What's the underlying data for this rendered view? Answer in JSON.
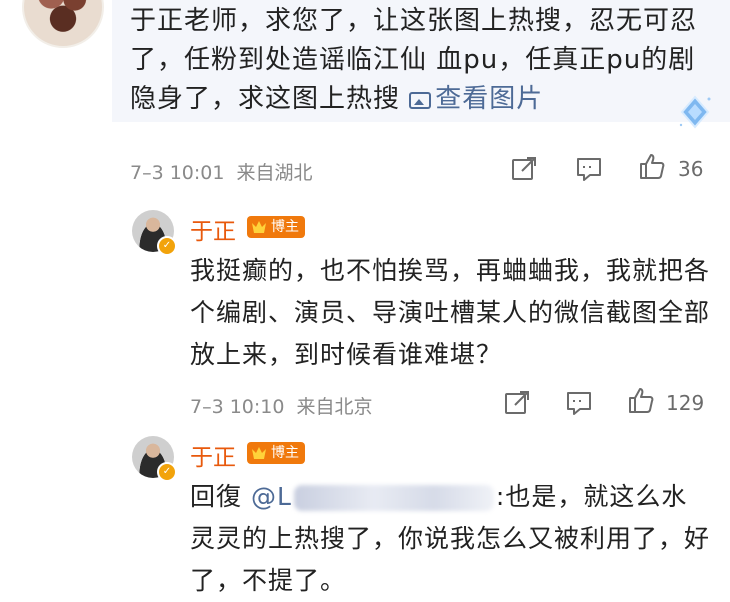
{
  "top_comment": {
    "text": "于正老师，求您了，让这张图上热搜，忍无可忍了，任粉到处造谣临江仙 血pu，任真正pu的剧隐身了，求这图上热搜 ",
    "view_image": "查看图片",
    "time": "7–3 10:01",
    "location": "来自湖北",
    "likes": "36"
  },
  "replies": [
    {
      "name": "于正",
      "badge": "博主",
      "text": "我挺癫的，也不怕挨骂，再蛐蛐我，我就把各个编剧、演员、导演吐槽某人的微信截图全部放上来，到时候看谁难堪？",
      "time": "7–3 10:10",
      "location": "来自北京",
      "likes": "129"
    },
    {
      "name": "于正",
      "badge": "博主",
      "reply_prefix": "回復",
      "mention": "@L",
      "text_after": ":也是，就这么水灵灵的上热搜了，你说我怎么又被利用了，好了，不提了。"
    }
  ],
  "colors": {
    "link": "#4d6a96",
    "name": "#e8590c",
    "badge": "#f0790c",
    "meta": "#8a8a8a"
  }
}
